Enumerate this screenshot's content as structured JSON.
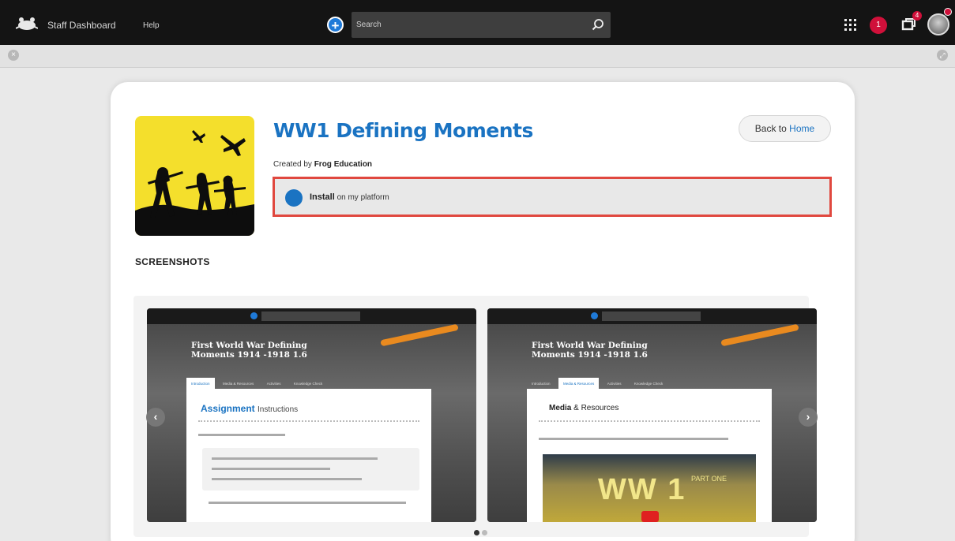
{
  "topbar": {
    "dashboard_label": "Staff Dashboard",
    "help_label": "Help",
    "search_placeholder": "Search",
    "notification_count": "1",
    "message_count": "4"
  },
  "app": {
    "title": "WW1 Defining Moments",
    "created_by_prefix": "Created by",
    "creator": "Frog Education",
    "back_prefix": "Back to",
    "back_link": "Home",
    "install_label": "Install",
    "install_suffix": "on my platform"
  },
  "screenshots": {
    "heading": "SCREENSHOTS",
    "items": [
      {
        "title": "First World War Defining Moments 1914 -1918 1.6",
        "tabs": [
          "Introduction",
          "Media & Resources",
          "Activities",
          "Knowledge Check"
        ],
        "active_tab": 0,
        "heading_bold": "Assignment",
        "heading_rest": "Instructions"
      },
      {
        "title": "First World War Defining Moments 1914 -1918 1.6",
        "tabs": [
          "Introduction",
          "Media & Resources",
          "Activities",
          "Knowledge Check"
        ],
        "active_tab": 1,
        "heading_bold": "Media",
        "heading_rest": "& Resources",
        "video_title": "WW 1",
        "video_subtitle": "PART ONE"
      }
    ],
    "page_count": 2,
    "active_page": 0
  },
  "colors": {
    "accent": "#1a73c2",
    "highlight_border": "#e0483f",
    "badge": "#d0103a"
  }
}
